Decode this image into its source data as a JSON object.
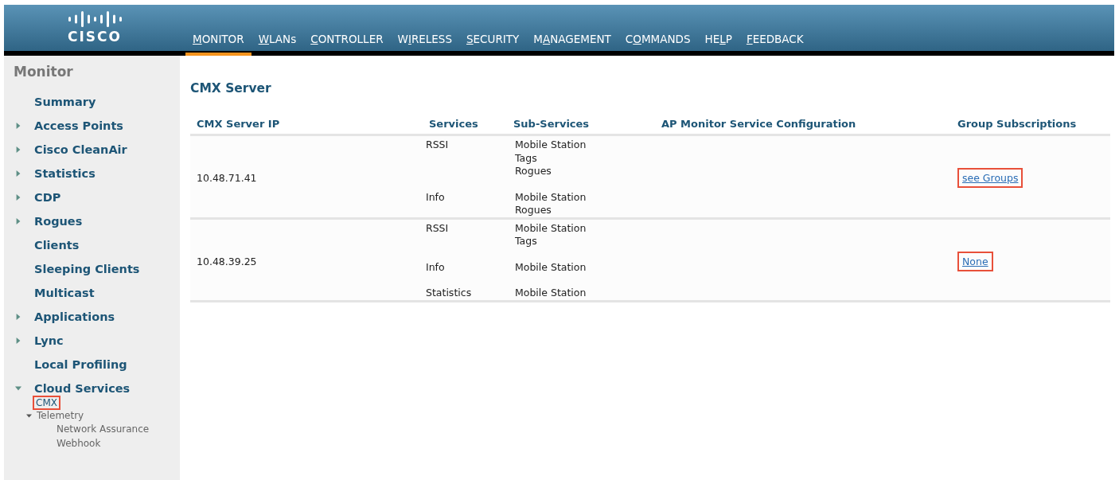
{
  "header": {
    "logo": "CISCO",
    "menu": [
      {
        "key": "M",
        "after": "ONITOR",
        "selected": true
      },
      {
        "key": "W",
        "after": "LANs",
        "selected": false
      },
      {
        "key": "C",
        "after": "ONTROLLER",
        "selected": false
      },
      {
        "before": "W",
        "key": "I",
        "after": "RELESS",
        "selected": false
      },
      {
        "key": "S",
        "after": "ECURITY",
        "selected": false
      },
      {
        "before": "M",
        "key": "A",
        "after": "NAGEMENT",
        "selected": false
      },
      {
        "before": "C",
        "key": "O",
        "after": "MMANDS",
        "selected": false
      },
      {
        "before": "HE",
        "key": "L",
        "after": "P",
        "selected": false
      },
      {
        "key": "F",
        "after": "EEDBACK",
        "selected": false
      }
    ]
  },
  "sidebar": {
    "title": "Monitor",
    "items": [
      {
        "label": "Summary",
        "kind": "link"
      },
      {
        "label": "Access Points",
        "kind": "folder",
        "expanded": false
      },
      {
        "label": "Cisco CleanAir",
        "kind": "folder",
        "expanded": false
      },
      {
        "label": "Statistics",
        "kind": "folder",
        "expanded": false
      },
      {
        "label": "CDP",
        "kind": "folder",
        "expanded": false
      },
      {
        "label": "Rogues",
        "kind": "folder",
        "expanded": false
      },
      {
        "label": "Clients",
        "kind": "link"
      },
      {
        "label": "Sleeping Clients",
        "kind": "link"
      },
      {
        "label": "Multicast",
        "kind": "link"
      },
      {
        "label": "Applications",
        "kind": "folder",
        "expanded": false
      },
      {
        "label": "Lync",
        "kind": "folder",
        "expanded": false
      },
      {
        "label": "Local Profiling",
        "kind": "link"
      },
      {
        "label": "Cloud Services",
        "kind": "folder",
        "expanded": true,
        "children": [
          {
            "label": "CMX",
            "highlighted": true
          },
          {
            "label": "Telemetry",
            "highlighted": false,
            "expanded": true,
            "children": [
              {
                "label": "Network Assurance"
              },
              {
                "label": "Webhook"
              }
            ]
          }
        ]
      }
    ]
  },
  "content": {
    "title": "CMX Server",
    "table": {
      "columns": [
        "CMX Server IP",
        "Services",
        "Sub-Services",
        "AP Monitor Service Configuration",
        "Group Subscriptions"
      ],
      "rows": [
        {
          "ip": "10.48.71.41",
          "services": [
            {
              "name": "RSSI",
              "subs": [
                "Mobile Station",
                "Tags",
                "Rogues"
              ]
            },
            {
              "name": "Info",
              "subs": [
                "Mobile Station",
                "Rogues"
              ]
            }
          ],
          "groups": {
            "label": "see Groups",
            "highlighted": true
          }
        },
        {
          "ip": "10.48.39.25",
          "services": [
            {
              "name": "RSSI",
              "subs": [
                "Mobile Station",
                "Tags"
              ]
            },
            {
              "name": "Info",
              "subs": [
                "Mobile Station"
              ]
            },
            {
              "name": "Statistics",
              "subs": [
                "Mobile Station"
              ]
            }
          ],
          "groups": {
            "label": "None",
            "highlighted": true
          }
        }
      ]
    }
  }
}
